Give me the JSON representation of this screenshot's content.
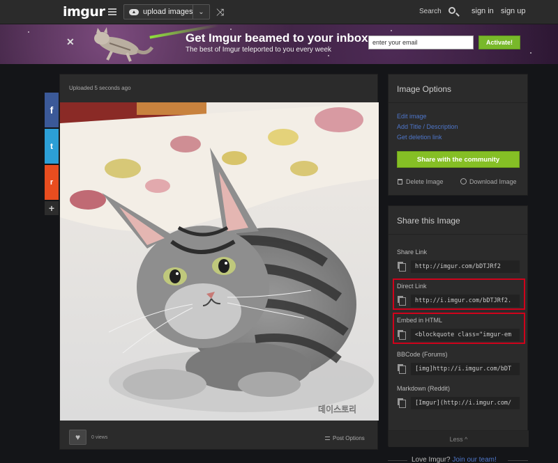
{
  "nav": {
    "logo": "imgur",
    "upload_label": "upload images",
    "search_label": "Search",
    "signin": "sign in",
    "signup": "sign up"
  },
  "banner": {
    "title": "Get Imgur beamed to your inbox",
    "subtitle": "The best of Imgur teleported to you every week",
    "email_placeholder": "enter your email",
    "button": "Activate!"
  },
  "social": {
    "facebook": "f",
    "twitter": "t",
    "reddit": "r",
    "more": "+"
  },
  "image": {
    "uploaded": "Uploaded 5 seconds ago",
    "views": "0 views",
    "post_options": "Post Options",
    "watermark": "데이스토리"
  },
  "options": {
    "title": "Image Options",
    "links": [
      "Edit image",
      "Add Title / Description",
      "Get deletion link"
    ],
    "share_button": "Share with the community",
    "delete": "Delete Image",
    "download": "Download Image"
  },
  "share": {
    "title": "Share this Image",
    "fields": [
      {
        "label": "Share Link",
        "value": "http://imgur.com/bDTJRf2"
      },
      {
        "label": "Direct Link",
        "value": "http://i.imgur.com/bDTJRf2."
      },
      {
        "label": "Embed in HTML",
        "value": "<blockquote class=\"imgur-em"
      },
      {
        "label": "BBCode (Forums)",
        "value": "[img]http://i.imgur.com/bDT"
      },
      {
        "label": "Markdown (Reddit)",
        "value": "[Imgur](http://i.imgur.com/"
      }
    ],
    "less": "Less ^"
  },
  "footer": {
    "text": "Love Imgur?",
    "link": "Join our team!"
  },
  "colors": {
    "accent_green": "#85bf25",
    "link_blue": "#4e76c9",
    "highlight_red": "#d0021b"
  }
}
